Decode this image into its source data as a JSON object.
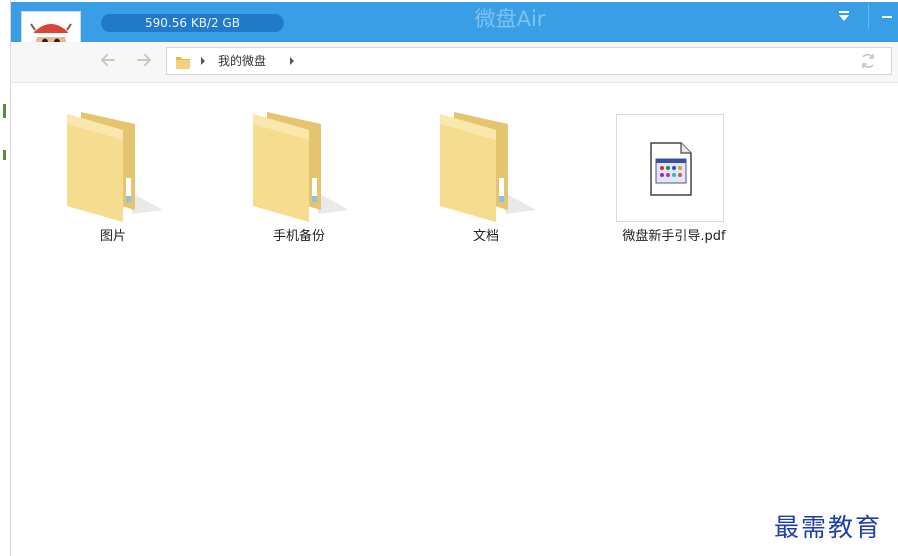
{
  "header": {
    "app_title": "微盘Air",
    "storage_quota": "590.56 KB/2 GB",
    "accent_color": "#3a9ee6"
  },
  "nav": {
    "breadcrumb": "我的微盘"
  },
  "files": [
    {
      "name": "图片",
      "type": "folder-icon"
    },
    {
      "name": "手机备份",
      "type": "folder-icon"
    },
    {
      "name": "文档",
      "type": "folder-icon"
    },
    {
      "name": "微盘新手引导.pdf",
      "type": "pdf-file-icon"
    }
  ],
  "watermark": "最需教育"
}
